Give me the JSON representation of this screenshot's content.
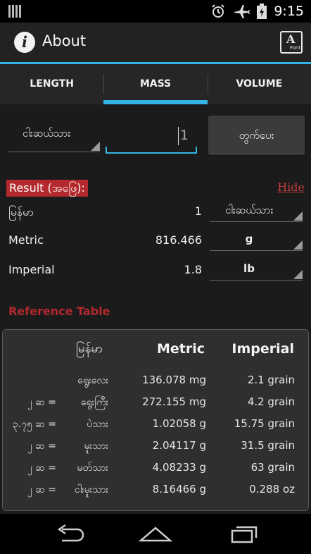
{
  "status_bar": {
    "time": "9:15",
    "icons": [
      "signal-bars-icon",
      "alarm-icon",
      "airplane-mode-icon",
      "battery-charging-icon"
    ]
  },
  "action_bar": {
    "title": "About",
    "info_icon": "info-icon",
    "font_button_glyph": "A",
    "font_button_caption": "Font"
  },
  "tabs": [
    {
      "label": "LENGTH",
      "active": false
    },
    {
      "label": "MASS",
      "active": true
    },
    {
      "label": "VOLUME",
      "active": false
    }
  ],
  "input": {
    "unit": "ငါးဆယ်သား",
    "value": "1",
    "calculate_label": "တွက်ပေး"
  },
  "result": {
    "label": "Result (အဖြေ):",
    "hide_label": "Hide",
    "rows": [
      {
        "name": "မြန်မာ",
        "value": "1",
        "unit": "ငါးဆယ်သား"
      },
      {
        "name": "Metric",
        "value": "816.466",
        "unit": "g"
      },
      {
        "name": "Imperial",
        "value": "1.8",
        "unit": "lb"
      }
    ]
  },
  "reference": {
    "title": "Reference Table",
    "headers": [
      "မြန်မာ",
      "Metric",
      "Imperial"
    ],
    "rows": [
      {
        "ratio": "",
        "myanmar": "ရွေးလေး",
        "metric": "136.078 mg",
        "imperial": "2.1 grain"
      },
      {
        "ratio": "၂ ဆ =",
        "myanmar": "ရွေးကြီး",
        "metric": "272.155 mg",
        "imperial": "4.2 grain"
      },
      {
        "ratio": "၃.၇၅ ဆ =",
        "myanmar": "ပဲသား",
        "metric": "1.02058 g",
        "imperial": "15.75 grain"
      },
      {
        "ratio": "၂ ဆ =",
        "myanmar": "မူးသား",
        "metric": "2.04117 g",
        "imperial": "31.5 grain"
      },
      {
        "ratio": "၂ ဆ =",
        "myanmar": "မတ်သား",
        "metric": "4.08233 g",
        "imperial": "63 grain"
      },
      {
        "ratio": "၂ ဆ =",
        "myanmar": "ငါးမူးသား",
        "metric": "8.16466 g",
        "imperial": "0.288 oz"
      }
    ]
  },
  "colors": {
    "accent": "#33b5e5",
    "result_red": "#b3292d",
    "background": "#1b1b1b"
  }
}
